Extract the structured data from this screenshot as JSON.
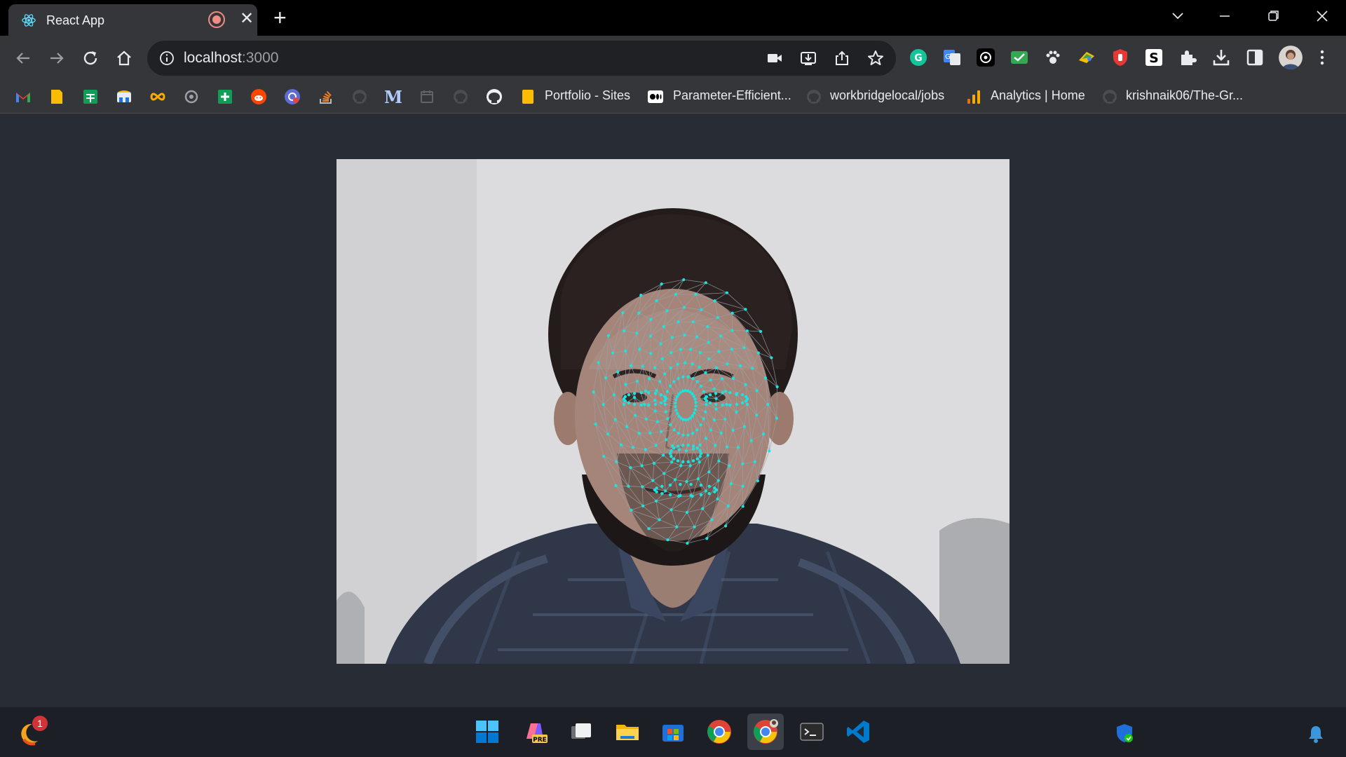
{
  "browser": {
    "tab": {
      "title": "React App"
    },
    "address_bar": {
      "host": "localhost",
      "port": ":3000"
    },
    "bookmarks": [
      {
        "icon": "gmail-icon"
      },
      {
        "icon": "keep-icon"
      },
      {
        "icon": "sheets-icon"
      },
      {
        "icon": "classroom-icon"
      },
      {
        "icon": "infinity-icon"
      },
      {
        "icon": "extensions-icon"
      },
      {
        "icon": "plus-sheet-icon"
      },
      {
        "icon": "reddit-icon"
      },
      {
        "icon": "chatgpt-icon"
      },
      {
        "icon": "stackoverflow-icon"
      },
      {
        "icon": "github-icon"
      },
      {
        "icon": "medium-m-icon"
      },
      {
        "icon": "calendar-icon"
      },
      {
        "icon": "github-icon"
      },
      {
        "icon": "github-icon"
      },
      {
        "icon": "folder-icon",
        "label": "Portfolio - Sites"
      },
      {
        "icon": "medium-icon",
        "label": "Parameter-Efficient..."
      },
      {
        "icon": "github-icon",
        "label": "workbridgelocal/jobs"
      },
      {
        "icon": "analytics-icon",
        "label": "Analytics | Home"
      },
      {
        "icon": "github-icon",
        "label": "krishnaik06/The-Gr..."
      }
    ]
  },
  "taskbar": {
    "notification_count": "1",
    "apps": [
      "start",
      "copilot-pre",
      "task-view",
      "file-explorer",
      "store",
      "chrome",
      "chrome-profile",
      "terminal",
      "vscode"
    ]
  },
  "colors": {
    "mesh": "#18e5e0",
    "page_bg": "#282c34",
    "tab_bg": "#35363a"
  }
}
